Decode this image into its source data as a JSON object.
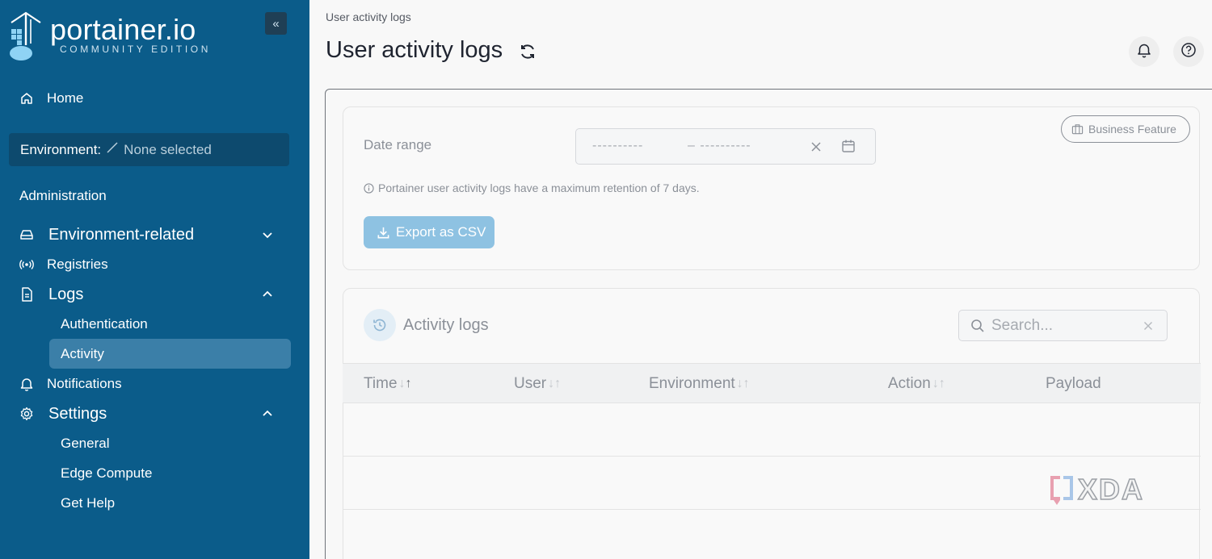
{
  "sidebar": {
    "logo_text": "portainer.io",
    "logo_subtext": "COMMUNITY EDITION",
    "collapse_icon": "«",
    "home_label": "Home",
    "environment_label": "Environment:",
    "environment_value": "None selected",
    "section_title": "Administration",
    "items": [
      {
        "label": "Environment-related",
        "icon": "drive-icon",
        "expanded": false
      },
      {
        "label": "Registries",
        "icon": "radio-icon"
      },
      {
        "label": "Logs",
        "icon": "file-icon",
        "expanded": true
      },
      {
        "label": "Authentication",
        "sub": true
      },
      {
        "label": "Activity",
        "sub": true,
        "active": true
      },
      {
        "label": "Notifications",
        "icon": "bell-icon"
      },
      {
        "label": "Settings",
        "icon": "gear-icon",
        "expanded": true
      },
      {
        "label": "General",
        "sub": true
      },
      {
        "label": "Edge Compute",
        "sub": true
      },
      {
        "label": "Get Help",
        "sub": true
      }
    ]
  },
  "header": {
    "breadcrumb": "User activity logs",
    "title": "User activity logs"
  },
  "filters": {
    "date_label": "Date range",
    "date_start_placeholder": "----------",
    "date_end_placeholder": "– ----------",
    "info_text": "Portainer user activity logs have a maximum retention of 7 days.",
    "export_label": "Export as CSV",
    "business_badge": "Business Feature"
  },
  "table": {
    "title": "Activity logs",
    "search_placeholder": "Search...",
    "columns": [
      "Time",
      "User",
      "Environment",
      "Action",
      "Payload"
    ]
  },
  "watermark": "XDA",
  "colors": {
    "sidebar_bg": "#0b5c8a",
    "active_item": "#3b7fa8",
    "export_button": "#8ec2e2"
  }
}
